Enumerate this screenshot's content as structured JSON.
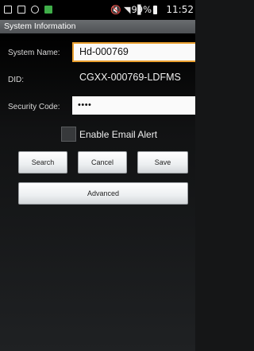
{
  "status_bar": {
    "battery": "99%",
    "time": "11:52"
  },
  "title_bar": {
    "title": "System Information"
  },
  "form": {
    "system_name_label": "System Name:",
    "system_name_value": "Hd-000769",
    "did_label": "DID:",
    "did_value": "CGXX-000769-LDFMS",
    "security_code_label": "Security Code:",
    "security_code_value": "••••",
    "email_alert_label": "Enable Email Alert",
    "email_alert_checked": false
  },
  "buttons": {
    "search": "Search",
    "cancel": "Cancel",
    "save": "Save",
    "advanced": "Advanced"
  },
  "colors": {
    "focus_border": "#e9a030",
    "title_bar": "#5c5f62",
    "background": "#151617"
  }
}
